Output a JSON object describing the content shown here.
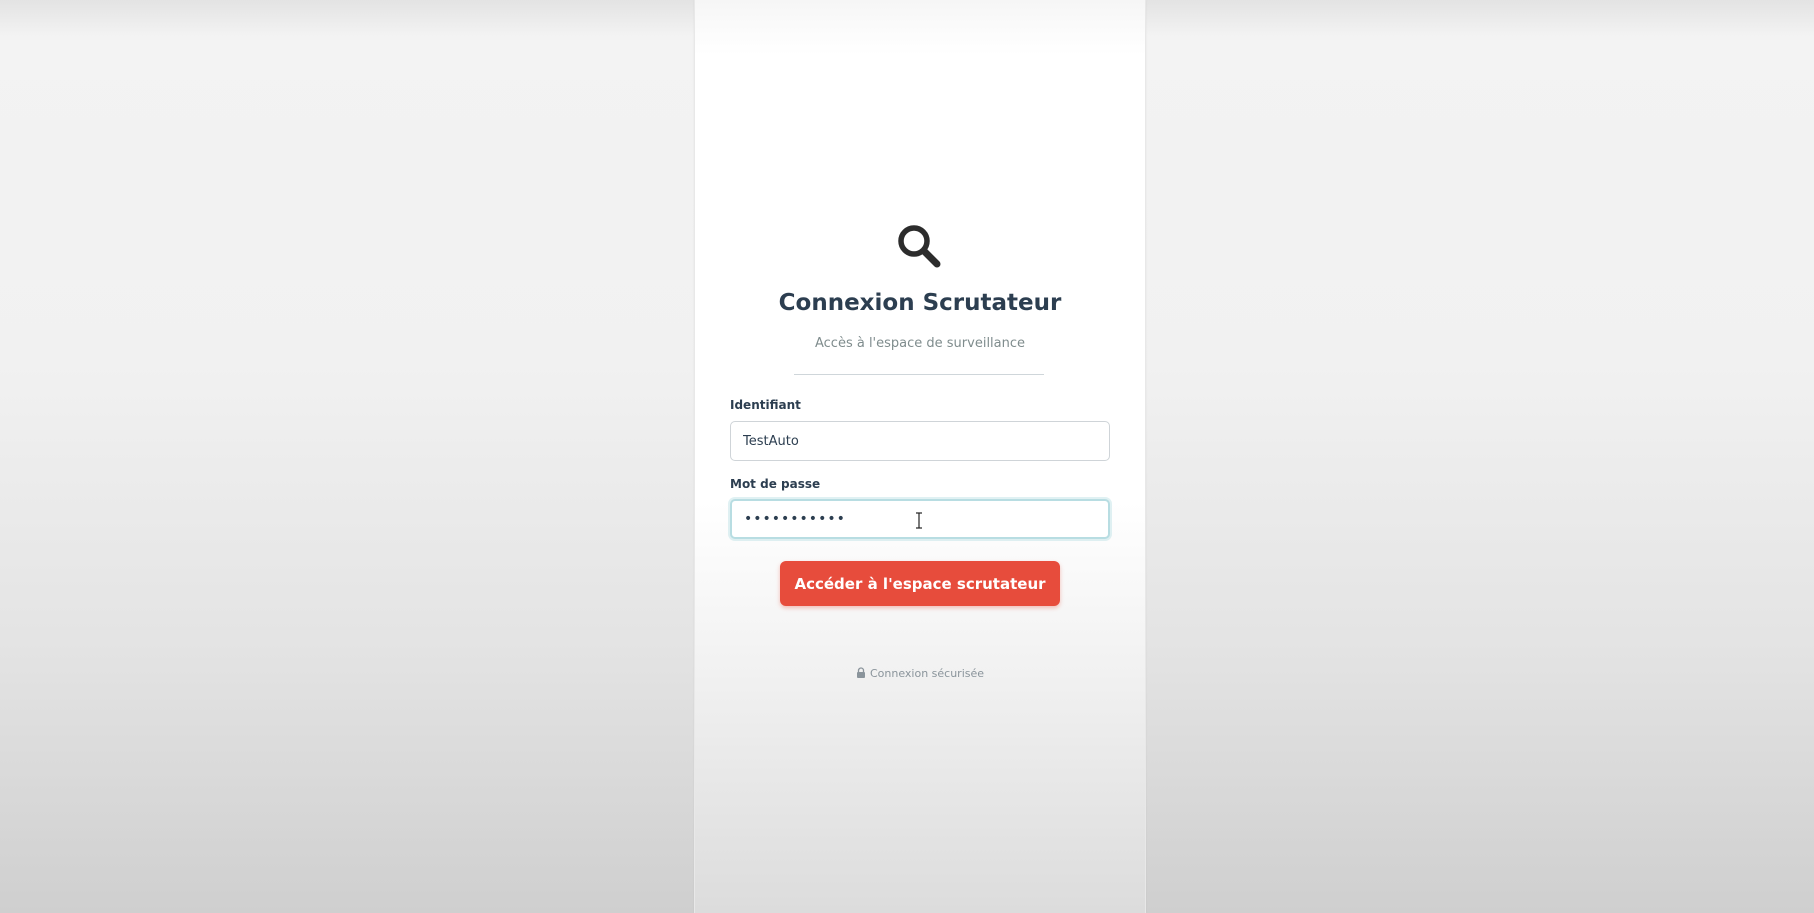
{
  "login": {
    "icon": "magnifier-icon",
    "title": "Connexion Scrutateur",
    "subtitle": "Accès à l'espace de surveillance",
    "username_label": "Identifiant",
    "username_value": "TestAuto",
    "password_label": "Mot de passe",
    "password_value": "•••••••••••",
    "submit_label": "Accéder à l'espace scrutateur",
    "secure_icon": "lock-icon",
    "secure_text": "Connexion sécurisée"
  },
  "colors": {
    "accent": "#e74c3c",
    "title": "#2c3e50",
    "focus": "#b8dde2"
  }
}
